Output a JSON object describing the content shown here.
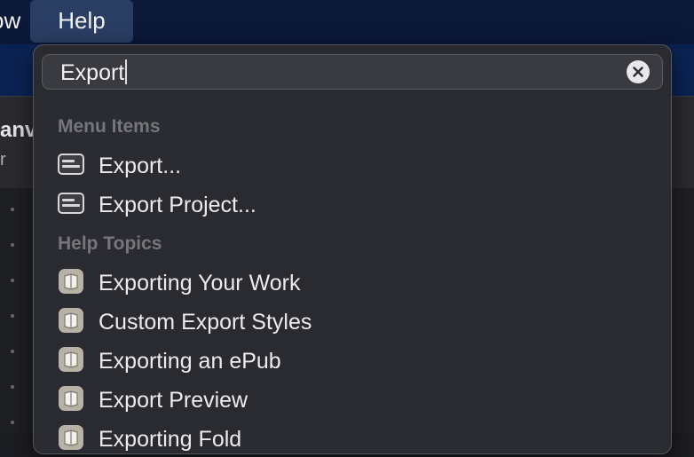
{
  "menubar": {
    "window_fragment": "ow",
    "help_label": "Help"
  },
  "toolbar": {
    "title_fragment": "anv",
    "sub_fragment": "r"
  },
  "popover": {
    "search": {
      "value": "Export",
      "clear_icon": "xmark-circle-icon"
    },
    "menu_items_header": "Menu Items",
    "menu_items": [
      {
        "label": "Export...",
        "icon": "menu-item-icon"
      },
      {
        "label": "Export Project...",
        "icon": "menu-item-icon"
      }
    ],
    "help_topics_header": "Help Topics",
    "help_topics": [
      {
        "label": "Exporting Your Work",
        "icon": "help-book-icon"
      },
      {
        "label": "Custom Export Styles",
        "icon": "help-book-icon"
      },
      {
        "label": "Exporting an ePub",
        "icon": "help-book-icon"
      },
      {
        "label": "Export Preview",
        "icon": "help-book-icon"
      },
      {
        "label": "Exporting Fold",
        "icon": "help-book-icon"
      }
    ]
  },
  "colors": {
    "menubar": "#0d1a3a",
    "help_highlight": "#2a3d63",
    "popover_bg": "#2b2c31",
    "section_header": "#75767c"
  }
}
